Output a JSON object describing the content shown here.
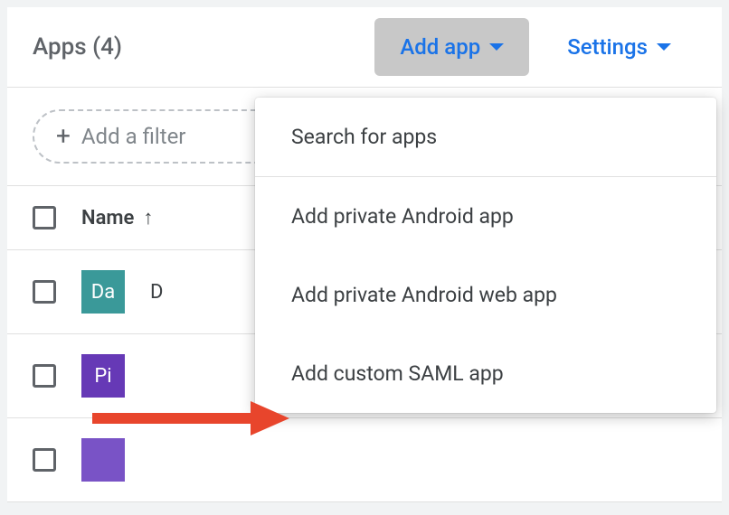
{
  "toolbar": {
    "title": "Apps (4)",
    "add_app_label": "Add app",
    "settings_label": "Settings"
  },
  "filter": {
    "placeholder": "Add a filter"
  },
  "table": {
    "header_name": "Name",
    "rows": [
      {
        "avatar": "Da",
        "name": "D",
        "color": "teal"
      },
      {
        "avatar": "Pi",
        "name": "",
        "color": "purple"
      },
      {
        "avatar": "",
        "name": "",
        "color": "purple2"
      }
    ]
  },
  "menu": {
    "items": [
      "Search for apps",
      "Add private Android app",
      "Add private Android web app",
      "Add custom SAML app"
    ]
  }
}
